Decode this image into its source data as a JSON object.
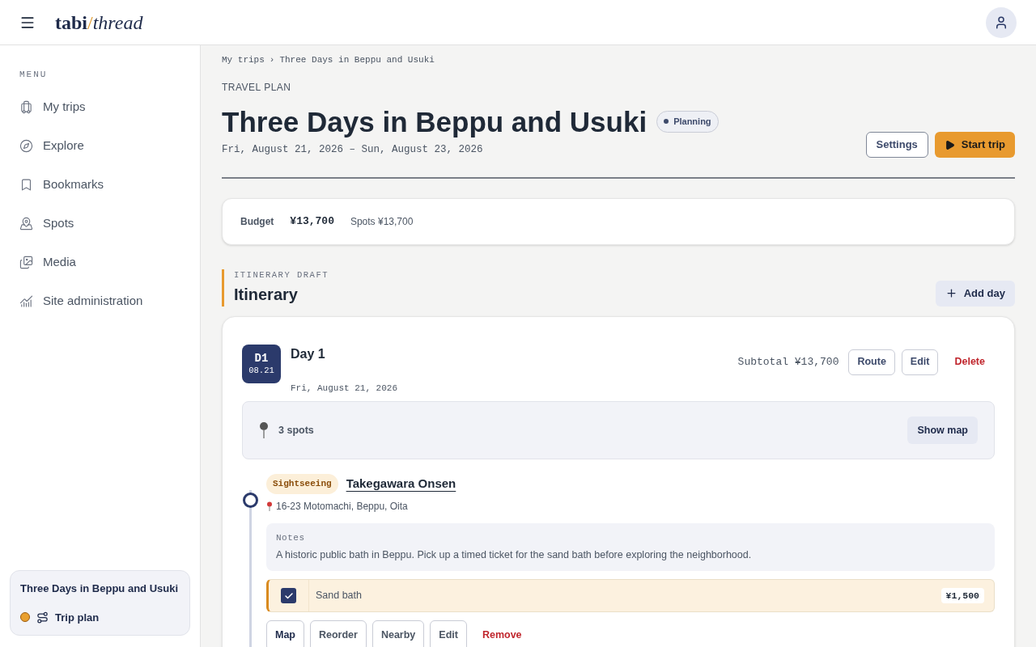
{
  "header": {
    "logo": [
      "tabi",
      "/",
      "thread"
    ]
  },
  "sidebar": {
    "heading": "MENU",
    "items": [
      {
        "label": "My trips",
        "selected": false
      },
      {
        "label": "Explore",
        "selected": false
      },
      {
        "label": "Bookmarks",
        "selected": false
      },
      {
        "label": "Spots",
        "selected": false
      },
      {
        "label": "Media",
        "selected": false
      },
      {
        "label": "Site administration",
        "selected": false
      }
    ],
    "current_trip": {
      "title": "Three Days in Beppu and Usuki",
      "link": "Trip plan"
    }
  },
  "breadcrumb": [
    "My trips",
    "›",
    "Three Days in Beppu and Usuki"
  ],
  "eyebrow": "TRAVEL PLAN",
  "title": "Three Days in Beppu and Usuki",
  "status": "Planning",
  "dates": "Fri, August 21, 2026 – Sun, August 23, 2026",
  "actions": {
    "settings": "Settings",
    "start": "Start trip"
  },
  "budget": {
    "label": "Budget",
    "total": "¥13,700",
    "detail": "Spots ¥13,700"
  },
  "itinerary": {
    "eyebrow": "ITINERARY DRAFT",
    "title": "Itinerary",
    "add": "Add day"
  },
  "days": [
    {
      "badge": "D1",
      "badge_date": "08.21",
      "title": "Day 1",
      "date": "Fri, August 21, 2026",
      "subtotal": "Subtotal ¥13,700",
      "buttons": [
        "Route",
        "Edit"
      ],
      "delete": "Delete",
      "spots_count": "3 spots",
      "show_map": "Show map",
      "spots": [
        {
          "tag": "Sightseeing",
          "name": "Takegawara Onsen",
          "address": "16-23 Motomachi, Beppu, Oita",
          "notes_label": "Notes",
          "notes": "A historic public bath in Beppu. Pick up a timed ticket for the sand bath before exploring the neighborhood.",
          "options": [
            {
              "label": "Sand bath",
              "price": "¥1,500",
              "checked": true
            }
          ],
          "buttons": [
            "Map",
            "Reorder",
            "Nearby",
            "Edit"
          ],
          "remove": "Remove"
        }
      ]
    }
  ]
}
